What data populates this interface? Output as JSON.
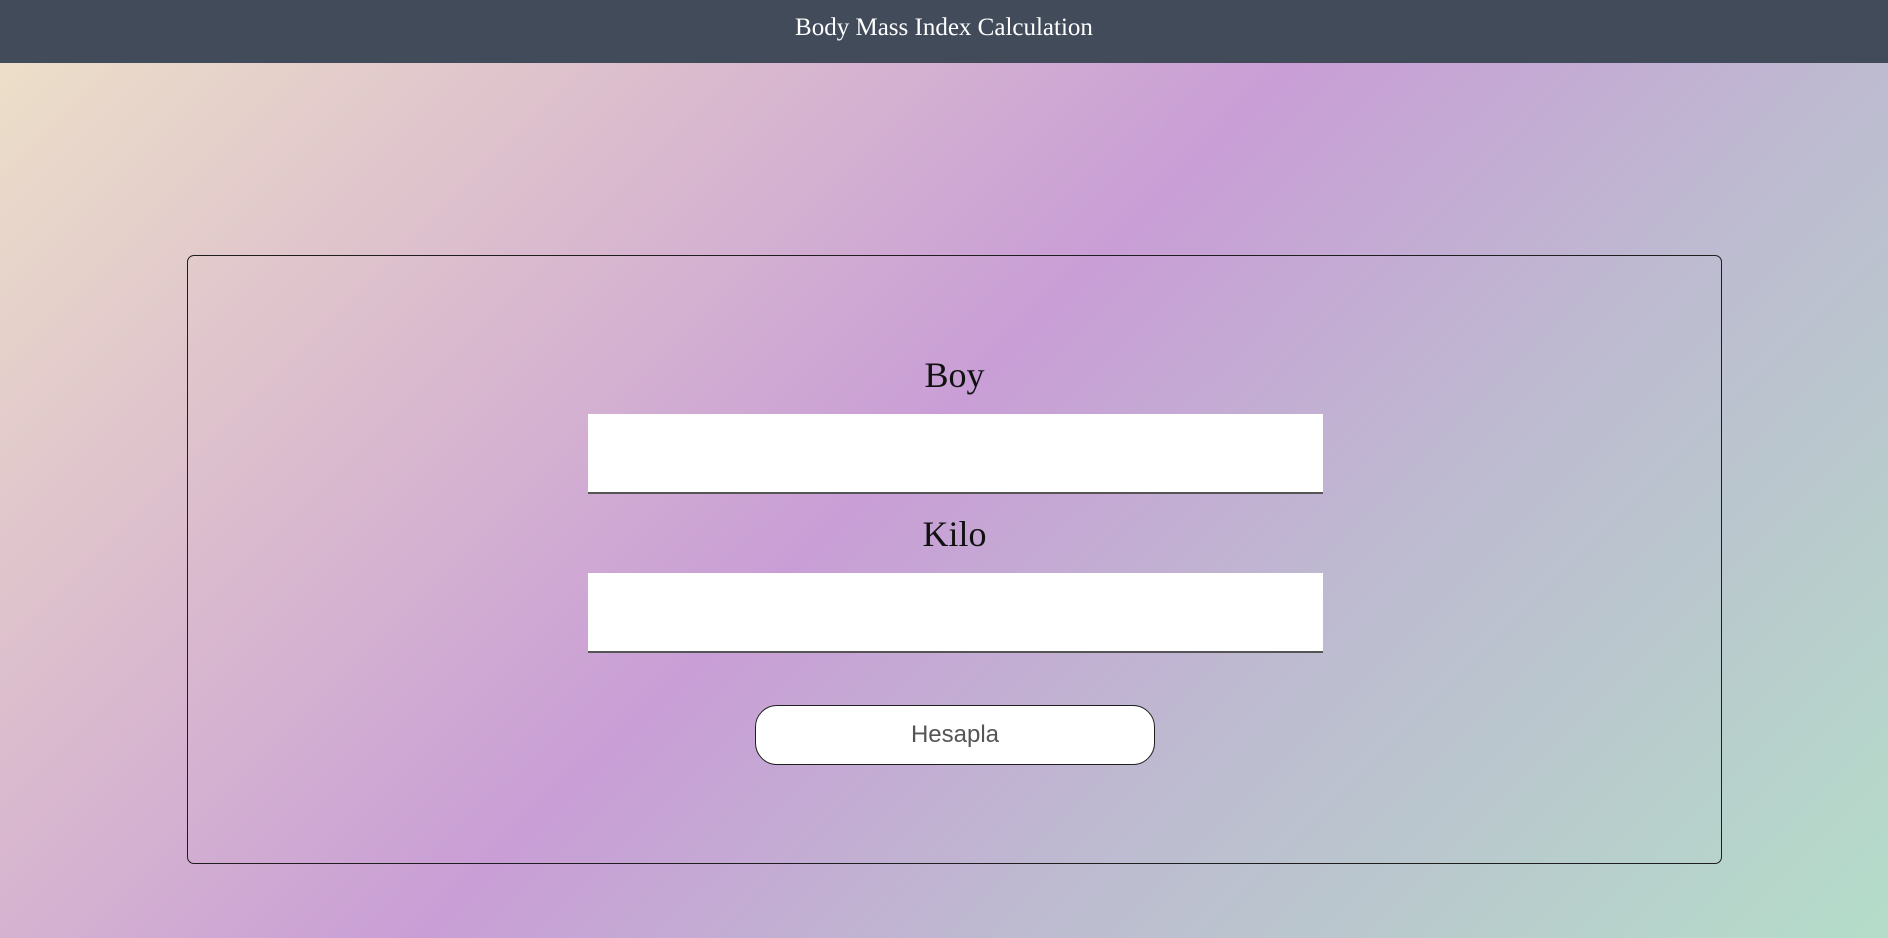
{
  "header": {
    "title": "Body Mass Index Calculation"
  },
  "form": {
    "height_label": "Boy",
    "height_value": "",
    "weight_label": "Kilo",
    "weight_value": "",
    "submit_label": "Hesapla"
  },
  "colors": {
    "header_background": "#414b5a",
    "header_text": "#ffffff",
    "gradient": [
      "#eee2c8",
      "#dcbecd",
      "#c99ed6",
      "#bdbcd0",
      "#b4ddc9"
    ]
  }
}
